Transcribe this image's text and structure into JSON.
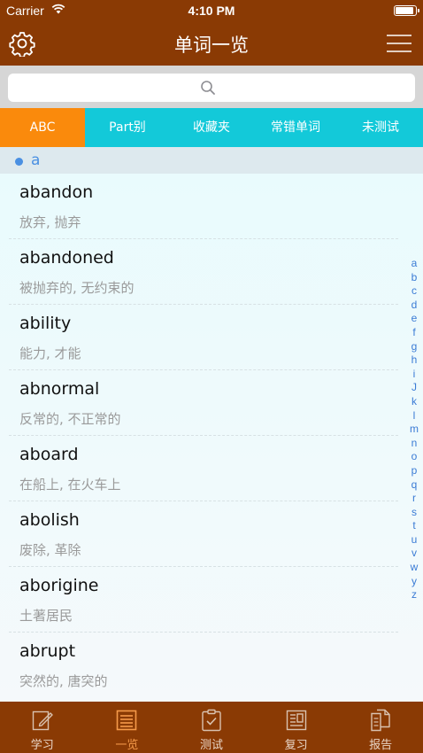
{
  "status": {
    "carrier": "Carrier",
    "time": "4:10 PM",
    "battery_level": 0.95
  },
  "header": {
    "title": "单词一览",
    "left_icon": "gear-icon",
    "right_icon": "menu-icon"
  },
  "search": {
    "placeholder": "",
    "icon": "search-icon"
  },
  "tabs": [
    {
      "label": "ABC"
    },
    {
      "label": "Part别"
    },
    {
      "label": "收藏夹"
    },
    {
      "label": "常错单词"
    },
    {
      "label": "未测试"
    }
  ],
  "section": {
    "letter": "a"
  },
  "words": [
    {
      "word": "abandon",
      "meaning": "放弃, 抛弃"
    },
    {
      "word": "abandoned",
      "meaning": "被抛弃的, 无约束的"
    },
    {
      "word": "ability",
      "meaning": "能力, 才能"
    },
    {
      "word": "abnormal",
      "meaning": "反常的, 不正常的"
    },
    {
      "word": "aboard",
      "meaning": "在船上, 在火车上"
    },
    {
      "word": "abolish",
      "meaning": "废除, 革除"
    },
    {
      "word": "aborigine",
      "meaning": "土著居民"
    },
    {
      "word": "abrupt",
      "meaning": "突然的, 唐突的"
    }
  ],
  "index_letters": [
    "a",
    "b",
    "c",
    "d",
    "e",
    "f",
    "g",
    "h",
    "i",
    "J",
    "k",
    "l",
    "m",
    "n",
    "o",
    "p",
    "q",
    "r",
    "s",
    "t",
    "u",
    "v",
    "w",
    "y",
    "z"
  ],
  "tabbar": [
    {
      "label": "学习",
      "icon": "pencil-icon"
    },
    {
      "label": "一览",
      "icon": "list-icon"
    },
    {
      "label": "测试",
      "icon": "clipboard-check-icon"
    },
    {
      "label": "复习",
      "icon": "book-review-icon"
    },
    {
      "label": "报告",
      "icon": "report-icon"
    }
  ],
  "colors": {
    "brand": "#8a3a04",
    "tab_bar": "#13c9d9",
    "tab_active": "#fa8a0c",
    "section_accent": "#4a90e2",
    "tabbar_active_label": "#f59a4a"
  }
}
